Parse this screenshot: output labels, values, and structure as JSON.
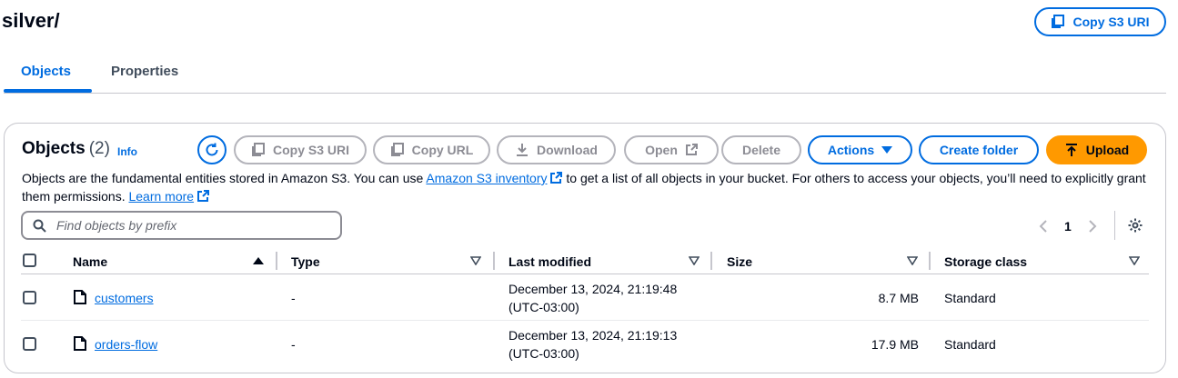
{
  "header": {
    "title": "silver/",
    "copy_s3_uri": "Copy S3 URI"
  },
  "tabs": [
    {
      "label": "Objects",
      "active": true
    },
    {
      "label": "Properties",
      "active": false
    }
  ],
  "objects_panel": {
    "title": "Objects",
    "count": "(2)",
    "info": "Info",
    "buttons": {
      "copy_s3_uri": "Copy S3 URI",
      "copy_url": "Copy URL",
      "download": "Download",
      "open": "Open",
      "delete": "Delete",
      "actions": "Actions",
      "create_folder": "Create folder",
      "upload": "Upload"
    },
    "description": {
      "part1": "Objects are the fundamental entities stored in Amazon S3. You can use ",
      "inventory_link": "Amazon S3 inventory",
      "part2": " to get a list of all objects in your bucket. For others to access your objects, you’ll need to explicitly grant them permissions. ",
      "learn_more": "Learn more"
    },
    "search": {
      "placeholder": "Find objects by prefix"
    },
    "pagination": {
      "current_page": "1"
    },
    "columns": {
      "name": "Name",
      "type": "Type",
      "last_modified": "Last modified",
      "size": "Size",
      "storage_class": "Storage class"
    },
    "rows": [
      {
        "name": "customers",
        "type": "-",
        "modified_line1": "December 13, 2024, 21:19:48",
        "modified_line2": "(UTC-03:00)",
        "size": "8.7 MB",
        "storage_class": "Standard"
      },
      {
        "name": "orders-flow",
        "type": "-",
        "modified_line1": "December 13, 2024, 21:19:13",
        "modified_line2": "(UTC-03:00)",
        "size": "17.9 MB",
        "storage_class": "Standard"
      }
    ]
  },
  "colors": {
    "accent": "#006ce0",
    "upload": "#ff9900",
    "disabled": "#b4b4bb",
    "text": "#000716"
  }
}
